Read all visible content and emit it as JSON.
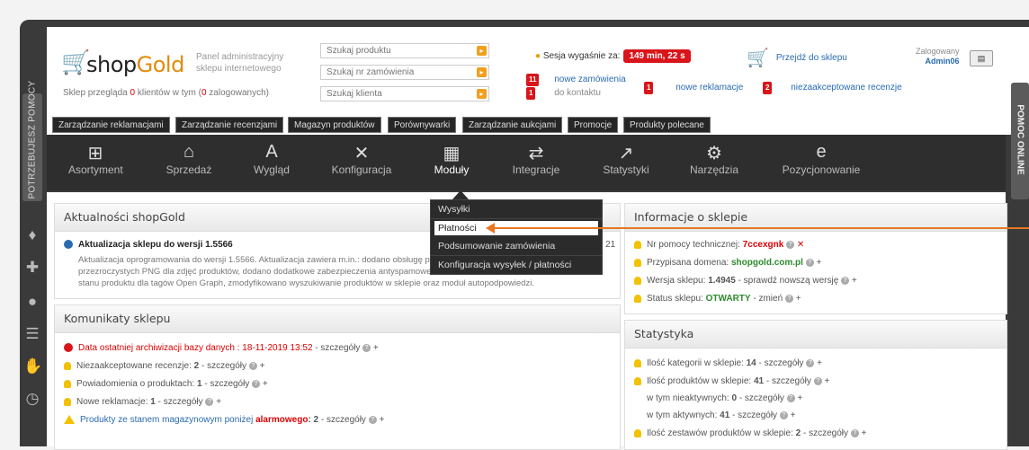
{
  "sidebar_left": {
    "help_tab": "POTRZEBUJESZ POMOCY"
  },
  "sidebar_right": {
    "online_tab": "POMOC ONLINE"
  },
  "logo": {
    "part1": "shop",
    "part2": "Gold"
  },
  "header": {
    "panel_title": "Panel administracyjny sklepu internetowego",
    "shop_stats_prefix": "Sklep przegląda ",
    "shop_stats_count": "0",
    "shop_stats_mid": " klientów w tym (",
    "shop_stats_logged": "0",
    "shop_stats_suffix": " zalogowanych)",
    "search_product_placeholder": "Szukaj produktu",
    "search_order_placeholder": "Szukaj nr zamówienia",
    "search_client_placeholder": "Szukaj klienta",
    "session_label": "Sesja wygaśnie za:",
    "session_value": "149 min, 22 s",
    "go_to_shop": "Przejdź do sklepu",
    "logged_label": "Zalogowany",
    "logged_user": "Admin06",
    "new_orders_count": "11",
    "new_orders_label": "nowe zamówienia",
    "new_contact_count": "1",
    "new_contact_label": "do kontaktu",
    "new_complaints_count": "1",
    "new_complaints_label": "nowe reklamacje",
    "unaccepted_reviews_count": "2",
    "unaccepted_reviews_label": "niezaakceptowane recenzje"
  },
  "tabs": [
    "Zarządzanie reklamacjami",
    "Zarządzanie recenzjami",
    "Magazyn produktów",
    "Porównywarki",
    "Zarządzanie aukcjami",
    "Promocje",
    "Produkty polecane"
  ],
  "nav": [
    "Asortyment",
    "Sprzedaż",
    "Wygląd",
    "Konfiguracja",
    "Moduły",
    "Integracje",
    "Statystyki",
    "Narzędzia",
    "Pozycjonowanie"
  ],
  "dropdown": [
    "Wysyłki",
    "Płatności",
    "Podsumowanie zamówienia",
    "Konfiguracja wysyłek / płatności"
  ],
  "news": {
    "title": "Aktualności shopGold",
    "item_title": "Aktualizacja sklepu do wersji 1.5566",
    "item_date_fragment": "21",
    "item_text_1": "Aktualizacja oprogramowania do wersji 1.5566. Aktualizacja zawiera m.in.: dodano obsługę plików",
    "item_text_2": "przezroczystych PNG dla zdjęć produktów, dodano dodatkowe zabezpieczenia antyspamowe, do",
    "item_text_3": "stanu produktu dla tagów Open Graph, zmodyfikowano wyszukiwanie produktów w sklepie oraz moduł autopodpowiedzi."
  },
  "messages": {
    "title": "Komunikaty sklepu",
    "rows": [
      {
        "text": "Data ostatniej archiwizacji bazy danych : 18-11-2019 13:52",
        "link": "szczegóły"
      },
      {
        "text": "Niezaakceptowane recenzje: ",
        "value": "2",
        "link": "szczegóły"
      },
      {
        "text": "Powiadomienia o produktach: ",
        "value": "1",
        "link": "szczegóły"
      },
      {
        "text": "Nowe reklamacje: ",
        "value": "1",
        "link": "szczegóły"
      },
      {
        "text": "Produkty ze stanem magazynowym poniżej ",
        "value": "alarmowego",
        "count": ": 2",
        "link": "szczegóły"
      }
    ]
  },
  "info": {
    "title": "Informacje o sklepie",
    "support_label": "Nr pomocy technicznej: ",
    "support_value": "7ccexgnk",
    "domain_label": "Przypisana domena: ",
    "domain_value": "shopgold.com.pl",
    "version_label": "Wersja sklepu: ",
    "version_value": "1.4945",
    "version_link": " - sprawdź nowszą wersję",
    "status_label": "Status sklepu: ",
    "status_value": "OTWARTY",
    "status_link": " - zmień"
  },
  "stats": {
    "title": "Statystyka",
    "rows": [
      {
        "label": "Ilość kategorii w sklepie: ",
        "value": "14",
        "link": " - szczegóły"
      },
      {
        "label": "Ilość produktów w sklepie: ",
        "value": "41",
        "link": " - szczegóły"
      },
      {
        "label": "w tym nieaktywnych: ",
        "value": "0",
        "link": " - szczegóły"
      },
      {
        "label": "w tym aktywnych: ",
        "value": "41",
        "link": " - szczegóły"
      },
      {
        "label": "Ilość zestawów produktów w sklepie: ",
        "value": "2",
        "link": " - szczegóły"
      }
    ]
  },
  "colors": {
    "accent": "#e38b0b",
    "badge": "#d9141a",
    "arrow": "#e87722",
    "link": "#2a6bb0"
  }
}
